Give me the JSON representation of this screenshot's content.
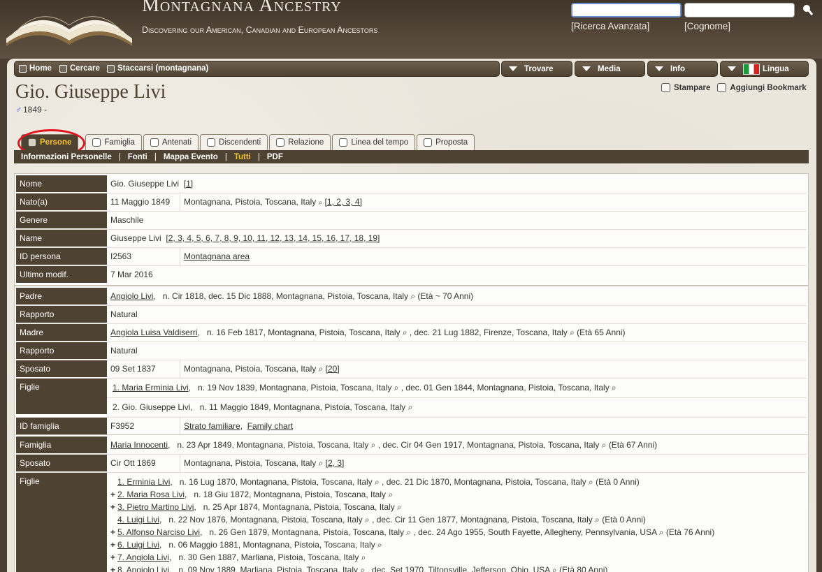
{
  "site": {
    "title": "Montagnana Ancestry",
    "subtitle": "Discovering our American, Canadian and European Ancestors",
    "search_placeholder": "",
    "surname_placeholder": "",
    "advanced_search": "[Ricerca Avanzata]",
    "surname_link": "[Cognome]"
  },
  "topnav": {
    "home": "Home",
    "search": "Cercare",
    "logout": "Staccarsi (montagnana)",
    "find": "Trovare",
    "media": "Media",
    "info": "Info",
    "language": "Lingua"
  },
  "person": {
    "name": "Gio. Giuseppe Livi",
    "dates": "1849 -",
    "print": "Stampare",
    "bookmark": "Aggiungi Bookmark"
  },
  "tabs": [
    "Persone",
    "Famiglia",
    "Antenati",
    "Discendenti",
    "Relazione",
    "Linea del tempo",
    "Proposta"
  ],
  "subnav": [
    "Informazioni Personelle",
    "Fonti",
    "Mappa Evento",
    "Tutti",
    "PDF"
  ],
  "individual": {
    "nome_label": "Nome",
    "nome_value": "Gio. Giuseppe Livi",
    "nome_ref": "[1]",
    "nato_label": "Nato(a)",
    "nato_date": "11 Maggio 1849",
    "nato_place": "Montagnana, Pistoia, Toscana, Italy",
    "nato_refs": "[1, 2, 3, 4]",
    "genere_label": "Genere",
    "genere_value": "Maschile",
    "name_label": "Name",
    "name_value": "Giuseppe Livi",
    "name_refs": "[2, 3, 4, 5, 6, 7, 8, 9, 10, 11, 12, 13, 14, 15, 16, 17, 18, 19]",
    "id_label": "ID persona",
    "id_value": "I2563",
    "id_link": "Montagnana area",
    "mod_label": "Ultimo modif.",
    "mod_value": "7 Mar 2016"
  },
  "parents": {
    "padre_label": "Padre",
    "padre_name": "Angiolo Livi",
    "padre_detail": "n. Cir 1818,   dec. 15 Dic 1888, Montagnana, Pistoia, Toscana, Italy ⌕  (Età ~ 70 Anni)",
    "rapporto1_label": "Rapporto",
    "rapporto1_value": "Natural",
    "madre_label": "Madre",
    "madre_name": "Angiola Luisa Valdiserri",
    "madre_detail": "n. 16 Feb 1817, Montagnana, Pistoia, Toscana, Italy ⌕ ,   dec. 21 Lug 1882, Firenze, Toscana, Italy ⌕  (Età 65 Anni)",
    "rapporto2_label": "Rapporto",
    "rapporto2_value": "Natural",
    "sposato_label": "Sposato",
    "sposato_date": "09 Set 1837",
    "sposato_place": "Montagnana, Pistoia, Toscana, Italy ⌕",
    "sposato_ref": "[20]",
    "figlie_label": "Figlie",
    "child1_name": "1. Maria Erminia Livi",
    "child1_detail": "n. 19 Nov 1839, Montagnana, Pistoia, Toscana, Italy ⌕ ,   dec. 01 Gen 1844, Montagnana, Pistoia, Toscana, Italy ⌕",
    "child2_name": "2. Gio. Giuseppe Livi",
    "child2_detail": "n. 11 Maggio 1849, Montagnana, Pistoia, Toscana, Italy ⌕",
    "fid_label": "ID famiglia",
    "fid_value": "F3952",
    "fid_link1": "Strato familiare",
    "fid_link2": "Family chart"
  },
  "family": {
    "famiglia_label": "Famiglia",
    "spouse_name": "Maria Innocenti",
    "spouse_detail": "n. 23 Apr 1849, Montagnana, Pistoia, Toscana, Italy ⌕ ,   dec. Cir 04 Gen 1917, Montagnana, Pistoia, Toscana, Italy ⌕  (Età 67 Anni)",
    "sposato_label": "Sposato",
    "sposato_date": "Cir Ott 1869",
    "sposato_place": "Montagnana, Pistoia, Toscana, Italy ⌕",
    "sposato_refs": "[2, 3]",
    "figlie_label": "Figlie",
    "children": [
      {
        "plus": "",
        "name": "1. Erminia Livi",
        "detail": "n. 16 Lug 1870, Montagnana, Pistoia, Toscana, Italy ⌕ ,   dec. 21 Dic 1870, Montagnana, Pistoia, Toscana, Italy ⌕  (Età 0 Anni)"
      },
      {
        "plus": "+",
        "name": "2. Maria Rosa Livi",
        "detail": "n. 18 Giu 1872, Montagnana, Pistoia, Toscana, Italy ⌕"
      },
      {
        "plus": "+",
        "name": "3. Pietro Martino Livi",
        "detail": "n. 25 Apr 1874, Montagnana, Pistoia, Toscana, Italy ⌕"
      },
      {
        "plus": "",
        "name": "4. Luigi Livi",
        "detail": "n. 22 Nov 1876, Montagnana, Pistoia, Toscana, Italy ⌕ ,   dec. Cir 11 Gen 1877, Montagnana, Pistoia, Toscana, Italy ⌕  (Età 0 Anni)"
      },
      {
        "plus": "+",
        "name": "5. Alfonso Narciso Livi",
        "detail": "n. 26 Gen 1879, Montagnana, Pistoia, Toscana, Italy ⌕ ,   dec. 24 Ago 1955, South Fayette, Allegheny, Pennsylvania, USA ⌕  (Età 76 Anni)"
      },
      {
        "plus": "+",
        "name": "6. Luigi Livi",
        "detail": "n. 06 Maggio 1881, Montagnana, Pistoia, Toscana, Italy ⌕"
      },
      {
        "plus": "+",
        "name": "7. Angiola Livi",
        "detail": "n. 30 Gen 1887, Marliana, Pistoia, Toscana, Italy ⌕"
      },
      {
        "plus": "+",
        "name": "8. Angiolo Livi",
        "detail": "n. 09 Nov 1889, Marliana, Pistoia, Toscana, Italy ⌕ ,   dec. Set 1970, Tiltonsville, Jefferson, Ohio, USA ⌕  (Età 80 Anni)"
      }
    ]
  },
  "colors": {
    "panel_brown": "#4e4232",
    "active_tab_text": "#f1c232",
    "highlight": "#e0141e"
  }
}
